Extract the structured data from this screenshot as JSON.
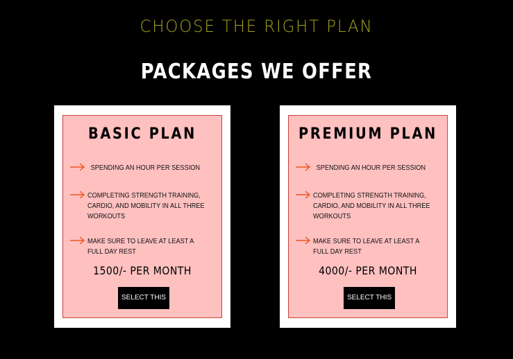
{
  "header": {
    "eyebrow": "CHOOSE THE RIGHT PLAN",
    "title": "PACKAGES WE OFFER"
  },
  "colors": {
    "background": "#000000",
    "eyebrow": "#a6a61c",
    "card_background": "#ffc0c0",
    "card_border": "#c9413c",
    "arrow": "#e8571f",
    "button": "#000000"
  },
  "plans": [
    {
      "title": "BASIC PLAN",
      "features": [
        "SPENDING AN HOUR PER SESSION",
        "COMPLETING STRENGTH TRAINING, CARDIO, AND MOBILITY IN ALL THREE WORKOUTS",
        "MAKE SURE TO LEAVE AT LEAST A FULL DAY REST"
      ],
      "price": "1500/- PER MONTH",
      "button_label": "SELECT THIS"
    },
    {
      "title": "PREMIUM PLAN",
      "features": [
        "SPENDING AN HOUR PER SESSION",
        "COMPLETING STRENGTH TRAINING, CARDIO, AND MOBILITY IN ALL THREE WORKOUTS",
        "MAKE SURE TO LEAVE AT LEAST A FULL DAY REST"
      ],
      "price": "4000/- PER MONTH",
      "button_label": "SELECT THIS"
    }
  ]
}
